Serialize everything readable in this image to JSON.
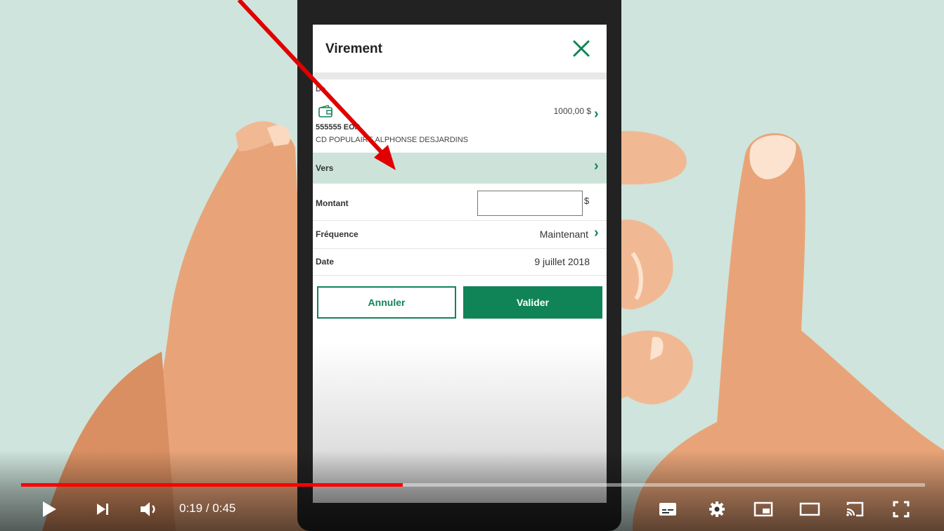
{
  "player": {
    "time_current": "0:19",
    "time_separator": " / ",
    "time_total": "0:45",
    "progress_fraction": 0.422,
    "accent_color": "#ff0000",
    "icons": [
      "play-icon",
      "next-icon",
      "volume-icon",
      "subtitles-icon",
      "settings-gear-icon",
      "miniplayer-icon",
      "theater-mode-icon",
      "cast-icon",
      "fullscreen-icon"
    ]
  },
  "screen": {
    "title": "Virement",
    "from_label": "De",
    "from_account": "555555 EOP",
    "from_name": "CD POPULAIRE ALPHONSE DESJARDINS",
    "from_amount": "1000,00 $",
    "to_label": "Vers",
    "amount_label": "Montant",
    "amount_value": "",
    "currency": "$",
    "frequency_label": "Fréquence",
    "frequency_value": "Maintenant",
    "date_label": "Date",
    "date_value": "9 juillet 2018",
    "cancel_label": "Annuler",
    "validate_label": "Valider",
    "brand_color": "#118457"
  }
}
